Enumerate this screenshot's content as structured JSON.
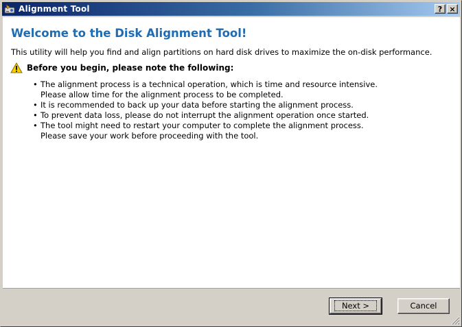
{
  "window": {
    "title": "Alignment Tool",
    "help_button": "?",
    "close_button": "×"
  },
  "page": {
    "heading": "Welcome to the Disk Alignment Tool!",
    "intro": "This utility will help you find and align partitions on hard disk drives to maximize the on-disk performance.",
    "note_title": "Before you begin, please note the following:",
    "bullets": [
      {
        "line1": "The alignment process is a technical operation, which is time and resource intensive.",
        "line2": "Please allow time for the alignment process to be completed."
      },
      {
        "line1": "It is recommended to back up your data before starting the alignment process.",
        "line2": ""
      },
      {
        "line1": "To prevent data loss, please do not interrupt the alignment operation once started.",
        "line2": ""
      },
      {
        "line1": "The tool might need to restart your computer to complete the alignment process.",
        "line2": "Please save your work before proceeding with the tool."
      }
    ]
  },
  "buttons": {
    "next": "Next >",
    "cancel": "Cancel"
  },
  "icons": {
    "app": "disk-tool-icon",
    "warning": "warning-icon",
    "grip": "resize-grip-icon"
  },
  "colors": {
    "heading": "#1e6db4",
    "titlebar_start": "#0a246a",
    "titlebar_end": "#a6caf0"
  }
}
